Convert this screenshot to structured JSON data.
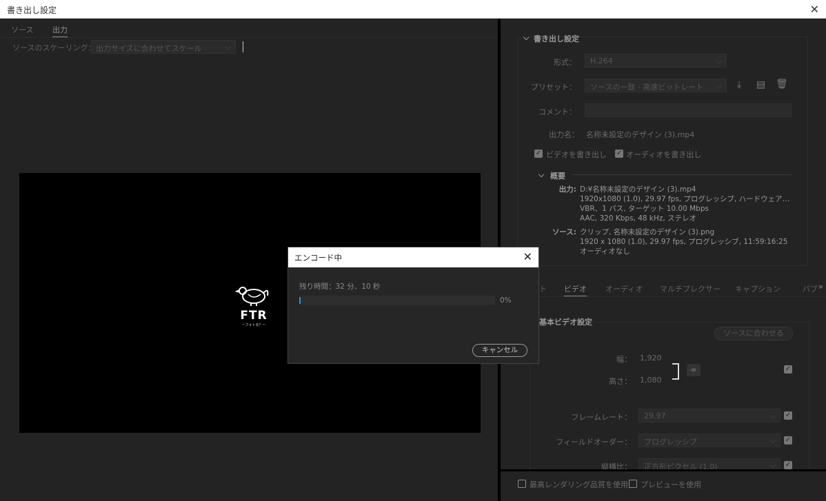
{
  "window": {
    "title": "書き出し設定",
    "close_icon": "✕"
  },
  "left": {
    "tabs": [
      {
        "label": "ソース"
      },
      {
        "label": "出力"
      }
    ],
    "scaling_label": "ソースのスケーリング：",
    "scaling_value": "出力サイズに合わせてスケール",
    "logo_text": "FTR",
    "logo_sub": "ーフォトる？ー"
  },
  "export": {
    "section_title": "書き出し設定",
    "format_label": "形式：",
    "format_value": "H.264",
    "preset_label": "プリセット：",
    "preset_value": "ソースの一致 - 高速ビットレート",
    "comment_label": "コメント：",
    "output_name_label": "出力名：",
    "output_name_value": "名称未設定のデザイン (3).mp4",
    "export_video": "ビデオを書き出し",
    "export_audio": "オーディオを書き出し",
    "summary_title": "概要",
    "summary_output_label": "出力:",
    "summary_output": [
      "D:¥名称未設定のデザイン (3).mp4",
      "1920x1080 (1.0), 29.97 fps, プログレッシブ, ハードウェア…",
      "VBR、1 パス, ターゲット 10.00 Mbps",
      "AAC, 320 Kbps, 48 kHz, ステレオ"
    ],
    "summary_source_label": "ソース:",
    "summary_source": [
      "クリップ, 名称未設定のデザイン (3).png",
      "1920 x 1080 (1.0), 29.97 fps, プログレッシブ, 11:59:16:25",
      "オーディオなし"
    ]
  },
  "tabs2": [
    {
      "label": "ト"
    },
    {
      "label": "ビデオ"
    },
    {
      "label": "オーディオ"
    },
    {
      "label": "マルチプレクサー"
    },
    {
      "label": "キャプション"
    },
    {
      "label": "パブ"
    }
  ],
  "video": {
    "section_title": "基本ビデオ設定",
    "match_source": "ソースに合わせる",
    "width_label": "幅：",
    "width_value": "1,920",
    "height_label": "高さ：",
    "height_value": "1,080",
    "framerate_label": "フレームレート：",
    "framerate_value": "29.97",
    "field_order_label": "フィールドオーダー：",
    "field_order_value": "プログレッシブ",
    "aspect_label": "縦横比：",
    "aspect_value": "正方形ピクセル (1.0)"
  },
  "bottom": {
    "max_render": "最高レンダリング品質を使用",
    "use_preview": "プレビューを使用"
  },
  "dialog": {
    "title": "エンコード中",
    "remaining": "残り時間：32 分、10 秒",
    "percent": "0%",
    "progress": 0,
    "cancel": "キャンセル"
  }
}
